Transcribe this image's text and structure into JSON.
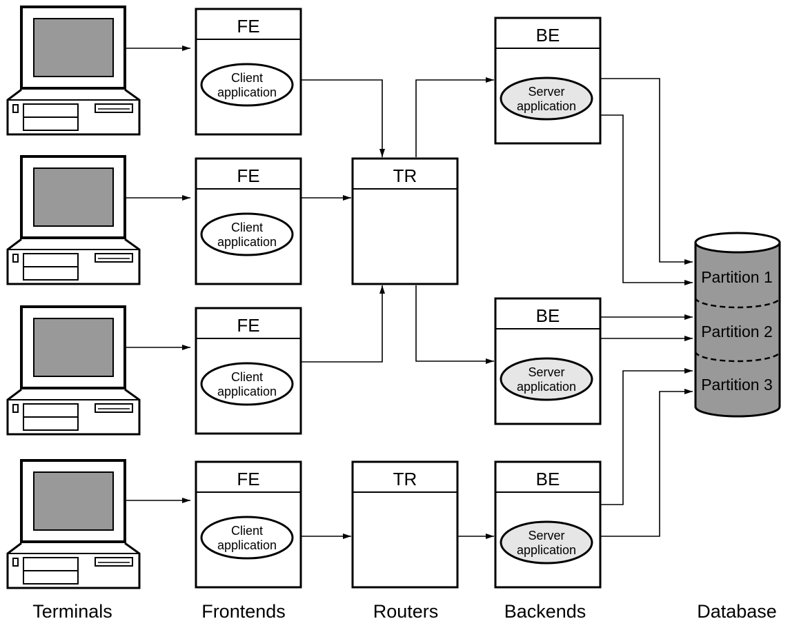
{
  "colors": {
    "screen": "#999999",
    "database": "#999999",
    "server_app": "#e6e6e6",
    "client_app": "#ffffff"
  },
  "frontends": [
    {
      "label": "FE",
      "app": [
        "Client",
        "application"
      ]
    },
    {
      "label": "FE",
      "app": [
        "Client",
        "application"
      ]
    },
    {
      "label": "FE",
      "app": [
        "Client",
        "application"
      ]
    },
    {
      "label": "FE",
      "app": [
        "Client",
        "application"
      ]
    }
  ],
  "routers": [
    {
      "label": "TR"
    },
    {
      "label": "TR"
    }
  ],
  "backends": [
    {
      "label": "BE",
      "app": [
        "Server",
        "application"
      ]
    },
    {
      "label": "BE",
      "app": [
        "Server",
        "application"
      ]
    },
    {
      "label": "BE",
      "app": [
        "Server",
        "application"
      ]
    }
  ],
  "database": {
    "partitions": [
      "Partition 1",
      "Partition 2",
      "Partition 3"
    ]
  },
  "columns": [
    "Terminals",
    "Frontends",
    "Routers",
    "Backends",
    "Database"
  ],
  "terminal_icon": "desktop-computer-icon",
  "database_icon": "cylinder-database-icon"
}
